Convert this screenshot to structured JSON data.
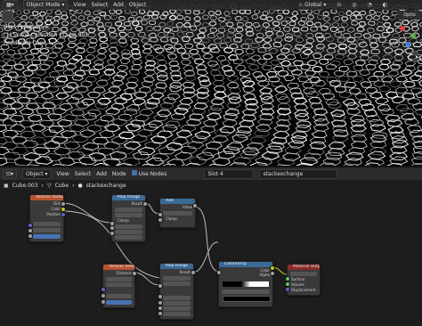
{
  "viewport": {
    "mode": "Object Mode",
    "menus": [
      "View",
      "Select",
      "Add",
      "Object"
    ],
    "transform": "Global",
    "options_label": "Optio",
    "overlay_lines": [
      "User Perspective",
      "(1) Scene Collection | Cube.003",
      "Rendering Done"
    ]
  },
  "node_editor": {
    "object_dropdown": "Object",
    "menus": [
      "View",
      "Select",
      "Add",
      "Node"
    ],
    "use_nodes_label": "Use Nodes",
    "slot": "Slot 4",
    "material": "stackexchange",
    "breadcrumb": [
      "Cube.003",
      "Cube",
      "stackexchange"
    ]
  },
  "nodes": {
    "voronoi1": {
      "title": "Voronoi Texture",
      "rows": [
        "Dist",
        "Color",
        "Position",
        "W",
        "Vector",
        "Scale",
        "Randomness"
      ]
    },
    "map1": {
      "title": "Map Range",
      "rows": [
        "Result",
        "Float",
        "Linear",
        "Clamp",
        "Value",
        "From Min",
        "From Max",
        "To Min",
        "To Max"
      ]
    },
    "add": {
      "title": "Add",
      "rows": [
        "Value",
        "Add",
        "Clamp",
        "Value"
      ]
    },
    "voronoi2": {
      "title": "Voronoi Texture",
      "rows": [
        "Distance",
        "3D",
        "Distance to Edge",
        "Vector",
        "Scale",
        "Randomness"
      ]
    },
    "map2": {
      "title": "Map Range",
      "rows": [
        "Result",
        "Float",
        "Linear",
        "Clamp",
        "Value",
        "From Min",
        "From Max",
        "To Min",
        "To Max"
      ]
    },
    "ramp": {
      "title": "ColorRamp",
      "rows": [
        "Color",
        "Alpha",
        "RGB",
        "Linear",
        "Pos"
      ]
    },
    "output": {
      "title": "Material Output",
      "rows": [
        "All",
        "Surface",
        "Volume",
        "Displacement"
      ]
    }
  },
  "colors": {
    "texture_header": "#b5522f",
    "converter_header": "#3a6a96",
    "output_header": "#8a2a2a",
    "socket_gray": "#a1a1a1",
    "socket_yellow": "#c7c729",
    "socket_purple": "#6363c7",
    "socket_green": "#63c763"
  }
}
